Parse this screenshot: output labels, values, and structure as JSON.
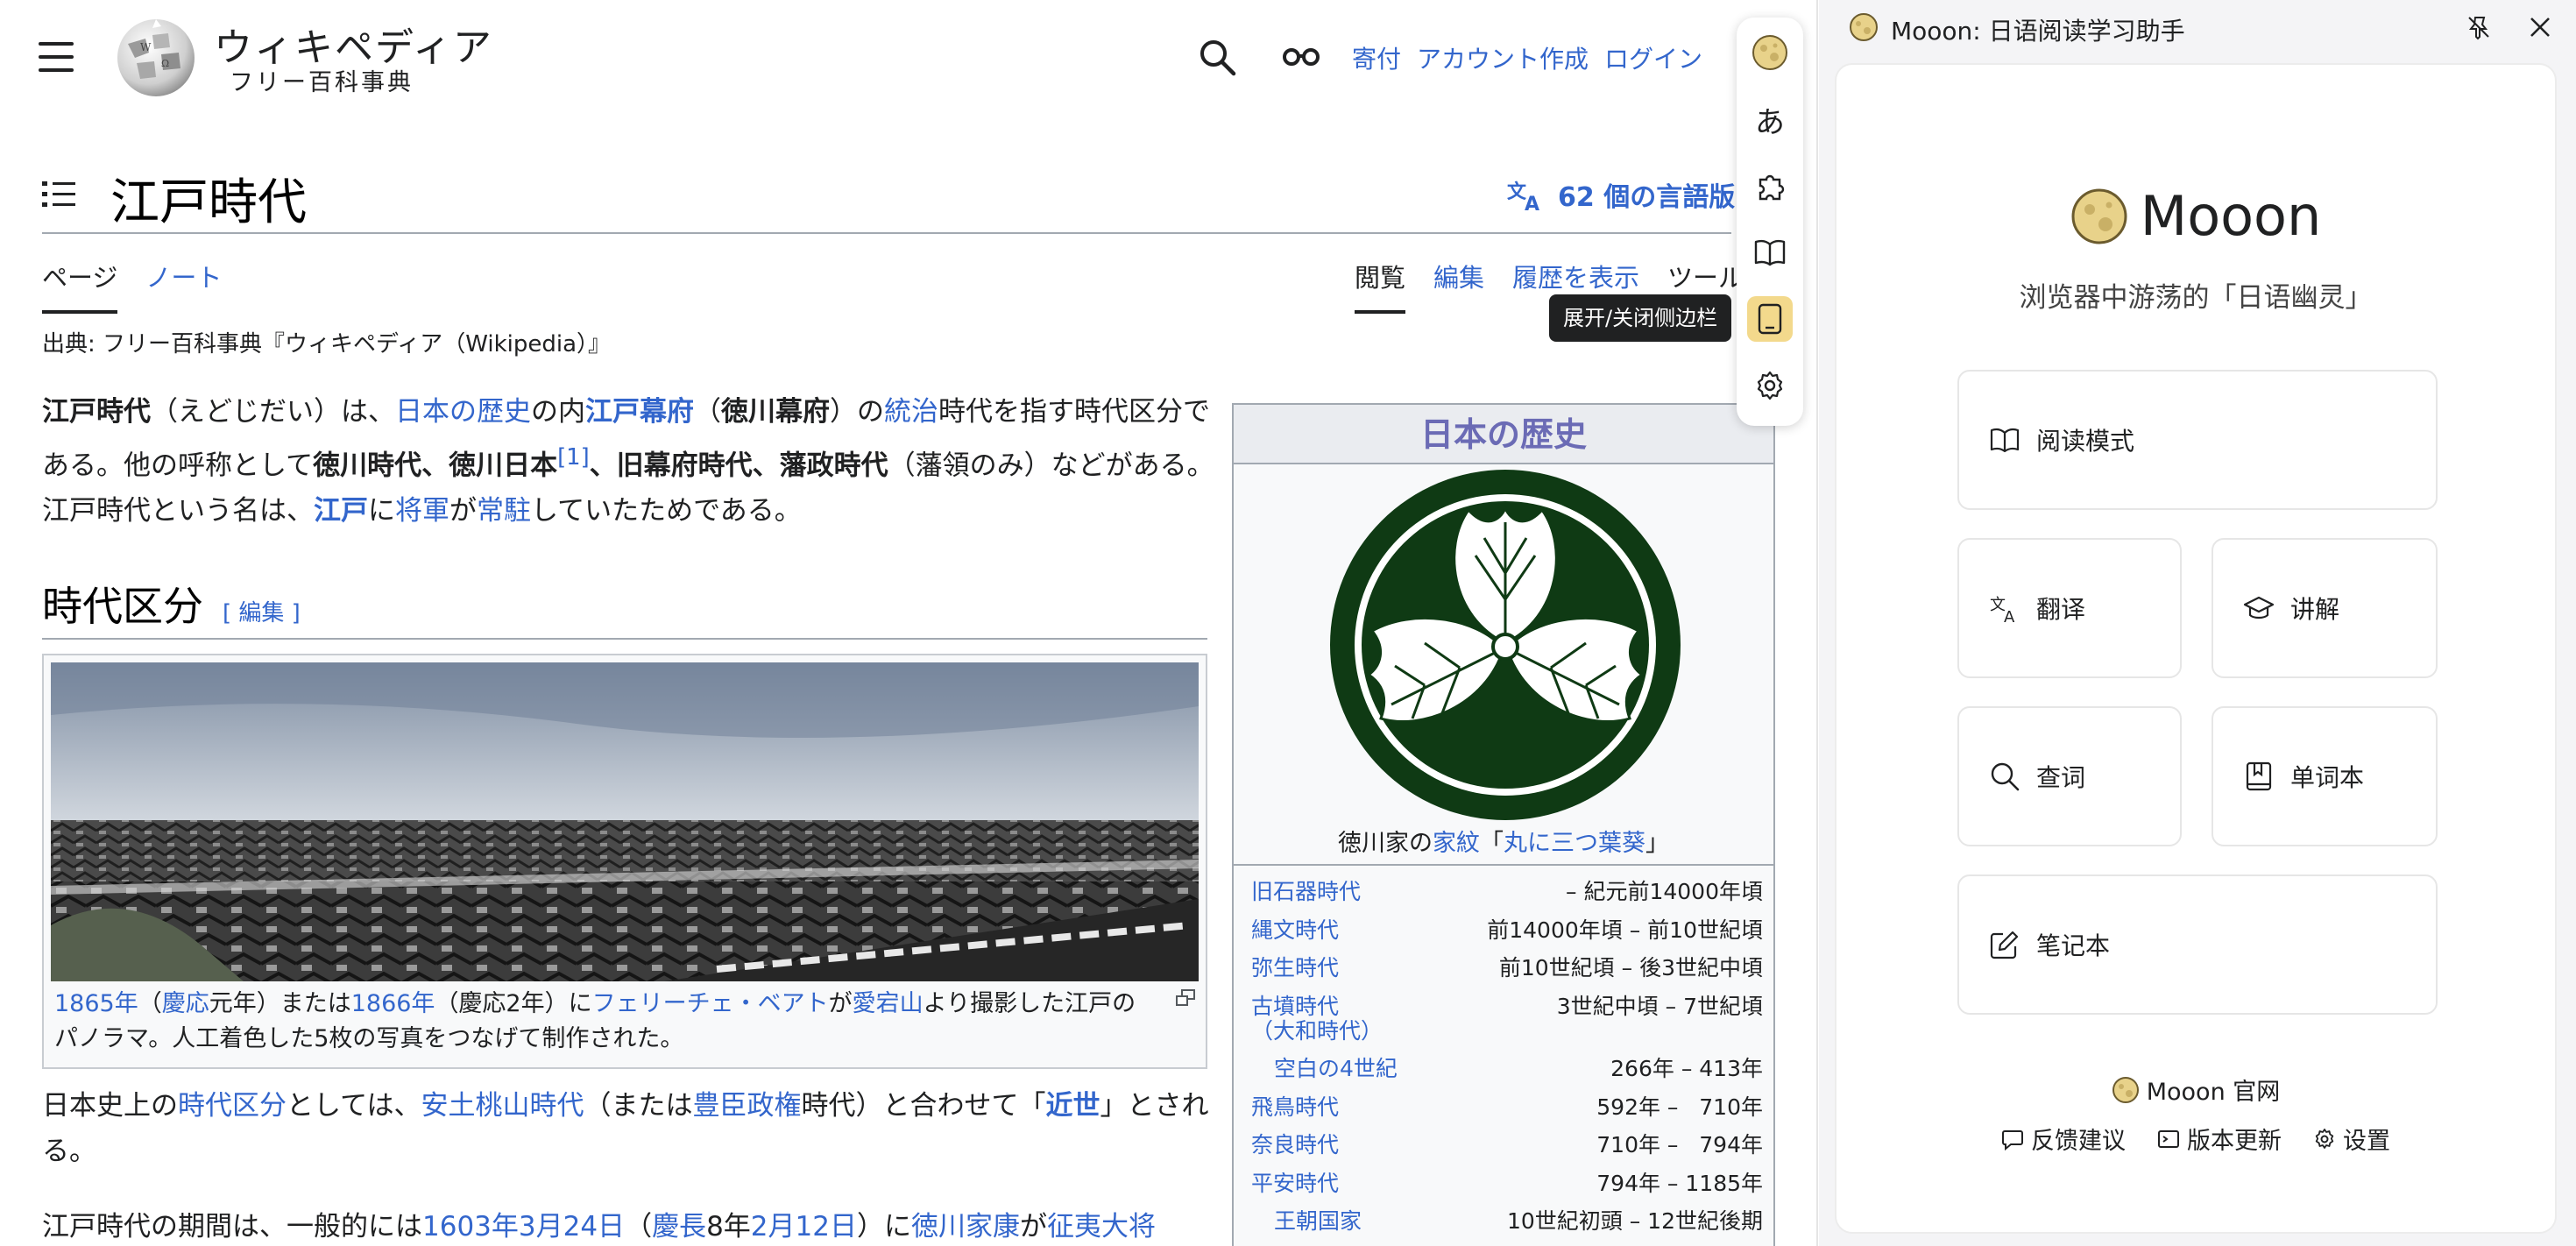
{
  "wiki": {
    "wordmark": "ウィキペディア",
    "tagline": "フリー百科事典",
    "top_links": [
      "寄付",
      "アカウント作成",
      "ログイン"
    ],
    "page_title": "江戸時代",
    "languages": "62 個の言語版",
    "tabs_left": [
      "ページ",
      "ノート"
    ],
    "tabs_right": [
      "閲覧",
      "編集",
      "履歴を表示",
      "ツール"
    ],
    "from": "出典: フリー百科事典『ウィキペディア（Wikipedia）』",
    "section_title": "時代区分",
    "section_edit": "[ 編集 ]",
    "caption": {
      "t1": "1865年",
      "t2": "（",
      "t3": "慶応",
      "t4": "元年）または",
      "t5": "1866年",
      "t6": "（慶応2年）に",
      "t7": "フェリーチェ・ベアト",
      "t8": "が",
      "t9": "愛宕山",
      "t10": "より撮影した江戸のパノラマ。人工着色した5枚の写真をつなげて制作された。"
    },
    "intro": {
      "t1": "江戸時代",
      "t2": "（えどじだい）は、",
      "t3": "日本の歴史",
      "t4": "の内",
      "t5": "江戸幕府",
      "t6": "（",
      "t7": "徳川幕府",
      "t8": "）の",
      "t9": "統治",
      "t10": "時代を指す時代区分である。他の呼称として",
      "t11": "徳川時代",
      "t12": "、",
      "t13": "徳川日本",
      "t14": "[1]",
      "t15": "、",
      "t16": "旧幕府時代",
      "t17": "、",
      "t18": "藩政時代",
      "t19": "（藩領のみ）などがある。江戸時代という名は、",
      "t20": "江戸",
      "t21": "に",
      "t22": "将軍",
      "t23": "が",
      "t24": "常駐",
      "t25": "していたためである。"
    },
    "para2": {
      "t1": "日本史上の",
      "t2": "時代区分",
      "t3": "としては、",
      "t4": "安土桃山時代",
      "t5": "（または",
      "t6": "豊臣政権",
      "t7": "時代）と合わせて「",
      "t8": "近世",
      "t9": "」とされる。"
    },
    "para3": {
      "t1": "江戸時代の期間は、一般的には",
      "t2": "1603年3月24日",
      "t3": "（",
      "t4": "慶長",
      "t5": "8年",
      "t6": "2月12日",
      "t7": "）に",
      "t8": "徳川家康",
      "t9": "が",
      "t10": "征夷大将"
    },
    "infobox": {
      "title": "日本の歴史",
      "crest_caption_1": "徳川家の",
      "crest_caption_2": "家紋",
      "crest_caption_3": "「",
      "crest_caption_4": "丸に三つ葉葵",
      "crest_caption_5": "」",
      "eras": [
        {
          "name": "旧石器時代",
          "range": "– 紀元前14000年頃"
        },
        {
          "name": "縄文時代",
          "range": "前14000年頃 – 前10世紀頃"
        },
        {
          "name": "弥生時代",
          "range": "前10世紀頃 – 後3世紀中頃"
        },
        {
          "name": "古墳時代",
          "range": "3世紀中頃 – 7世紀頃"
        },
        {
          "name": "（大和時代）",
          "range": ""
        },
        {
          "name": "空白の4世紀",
          "range": "266年 – 413年"
        },
        {
          "name": "飛鳥時代",
          "range": "592年 –   710年"
        },
        {
          "name": "奈良時代",
          "range": "710年 –   794年"
        },
        {
          "name": "平安時代",
          "range": "794年 – 1185年"
        },
        {
          "name": "王朝国家",
          "range": "10世紀初頭 – 12世紀後期"
        }
      ]
    }
  },
  "toolbar": {
    "buttons": [
      "mooon-logo-icon",
      "hiragana-icon",
      "puzzle-icon",
      "book-icon",
      "sidebar-toggle-icon",
      "settings-icon"
    ],
    "tooltip": "展开/关闭侧边栏",
    "active_color": "#f3d98c"
  },
  "panel": {
    "header_title": "Mooon: 日语阅读学习助手",
    "brand_name": "Mooon",
    "brand_subtitle": "浏览器中游荡的「日语幽灵」",
    "actions": {
      "reading": "阅读模式",
      "translate": "翻译",
      "explain": "讲解",
      "lookup": "查词",
      "vocab": "单词本",
      "notebook": "笔记本"
    },
    "official_site": "Mooon 官网",
    "footer": {
      "feedback": "反馈建议",
      "updates": "版本更新",
      "settings": "设置"
    }
  },
  "colors": {
    "link": "#3366cc",
    "crest_green": "#0f3a14",
    "infobox_title": "#6b6bb5"
  }
}
